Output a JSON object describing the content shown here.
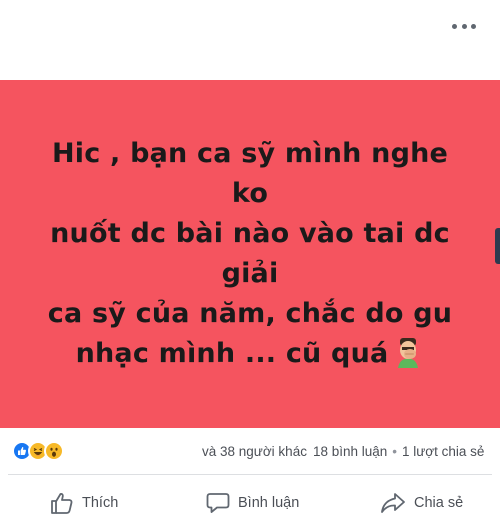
{
  "post": {
    "text_lines": [
      "Hic , bạn ca sỹ mình nghe ko",
      "nuốt dc bài nào vào tai dc giải",
      "ca sỹ của năm, chắc do gu",
      "nhạc mình ... cũ quá"
    ],
    "background_color": "#f5545f",
    "emoji": "facepalm-emoji"
  },
  "reactions": {
    "icons": [
      "like-reaction-icon",
      "haha-reaction-icon",
      "wow-reaction-icon"
    ],
    "others_text": "và 38 người khác",
    "comments_text": "18 bình luận",
    "separator": "•",
    "shares_text": "1 lượt chia sẻ"
  },
  "actions": {
    "like_label": "Thích",
    "comment_label": "Bình luận",
    "share_label": "Chia sẻ"
  },
  "colors": {
    "like_blue": "#1877f2",
    "haha_yellow": "#f7b928",
    "text_gray": "#4b4f56"
  }
}
